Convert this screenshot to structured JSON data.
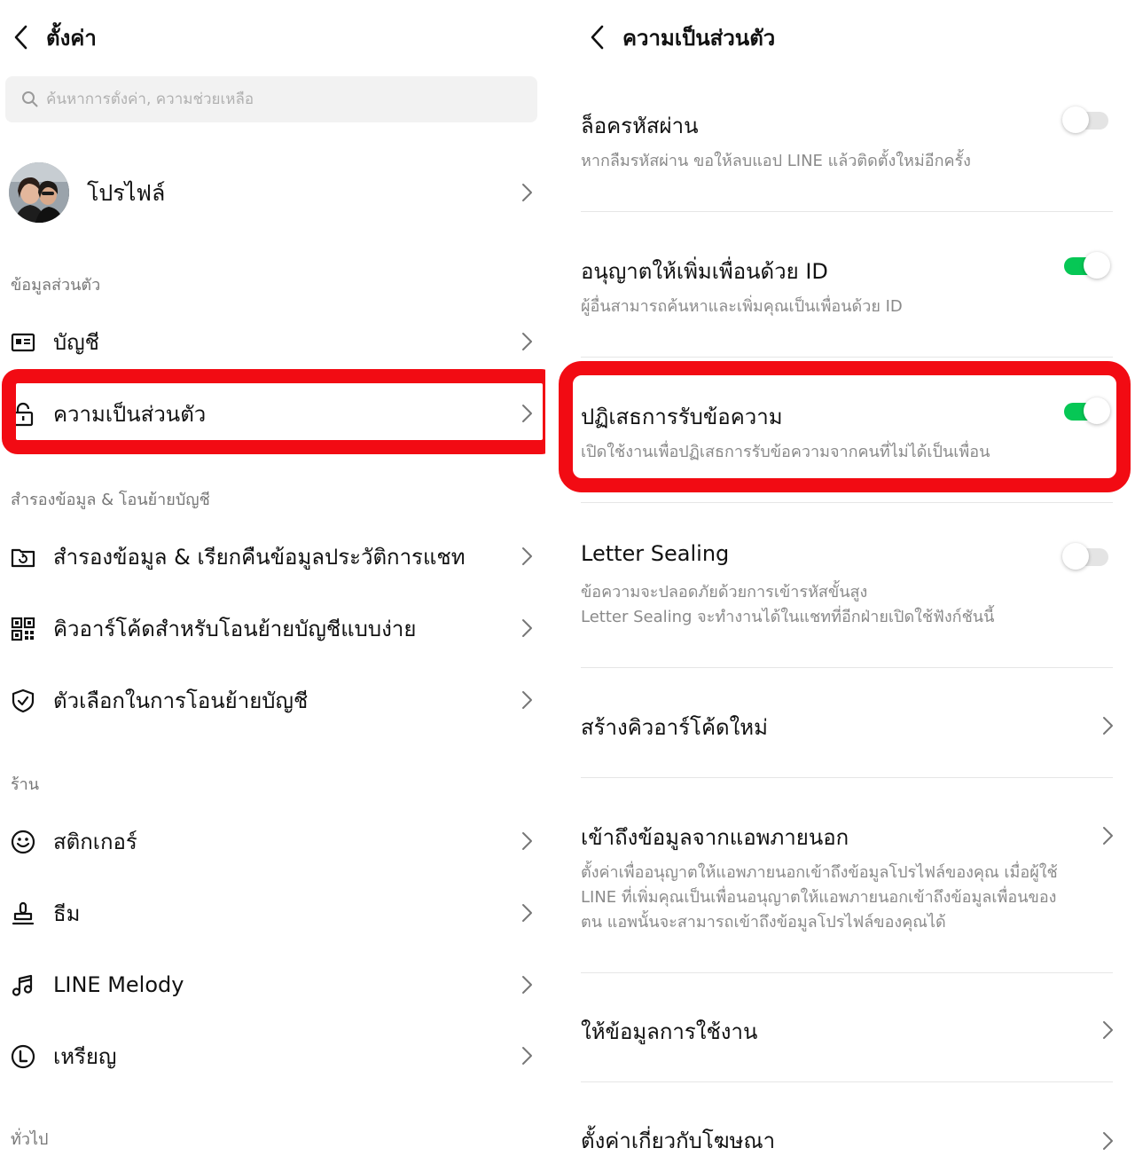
{
  "left": {
    "title": "ตั้งค่า",
    "search_placeholder": "ค้นหาการตั้งค่า, ความช่วยเหลือ",
    "profile_label": "โปรไฟล์",
    "sections": {
      "personal": "ข้อมูลส่วนตัว",
      "backup": "สำรองข้อมูล & โอนย้ายบัญชี",
      "shop": "ร้าน",
      "general": "ทั่วไป"
    },
    "items": {
      "account": "บัญชี",
      "privacy": "ความเป็นส่วนตัว",
      "backup_restore": "สำรองข้อมูล & เรียกคืนข้อมูลประวัติการแชท",
      "qr_transfer": "คิวอาร์โค้ดสำหรับโอนย้ายบัญชีแบบง่าย",
      "transfer_options": "ตัวเลือกในการโอนย้ายบัญชี",
      "stickers": "สติกเกอร์",
      "themes": "ธีม",
      "line_melody": "LINE Melody",
      "coins": "เหรียญ"
    }
  },
  "right": {
    "title": "ความเป็นส่วนตัว",
    "passcode_lock": {
      "title": "ล็อครหัสผ่าน",
      "desc": "หากลืมรหัสผ่าน ขอให้ลบแอป LINE แล้วติดตั้งใหม่อีกครั้ง",
      "enabled": false
    },
    "allow_add_by_id": {
      "title": "อนุญาตให้เพิ่มเพื่อนด้วย ID",
      "desc": "ผู้อื่นสามารถค้นหาและเพิ่มคุณเป็นเพื่อนด้วย ID",
      "enabled": true
    },
    "filter_messages": {
      "title": "ปฏิเสธการรับข้อความ",
      "desc": "เปิดใช้งานเพื่อปฏิเสธการรับข้อความจากคนที่ไม่ได้เป็นเพื่อน",
      "enabled": true
    },
    "letter_sealing": {
      "title": "Letter Sealing",
      "desc_line1": "ข้อความจะปลอดภัยด้วยการเข้ารหัสขั้นสูง",
      "desc_line2": "Letter Sealing จะทำงานได้ในแชทที่อีกฝ่ายเปิดใช้ฟังก์ชันนี้",
      "enabled": false
    },
    "new_qr": {
      "title": "สร้างคิวอาร์โค้ดใหม่"
    },
    "external_access": {
      "title": "เข้าถึงข้อมูลจากแอพภายนอก",
      "desc_line1": "ตั้งค่าเพื่ออนุญาตให้แอพภายนอกเข้าถึงข้อมูลโปรไฟล์ของคุณ เมื่อผู้ใช้",
      "desc_line2": "LINE ที่เพิ่มคุณเป็นเพื่อนอนุญาตให้แอพภายนอกเข้าถึงข้อมูลเพื่อนของ",
      "desc_line3": "ตน แอพนั้นจะสามารถเข้าถึงข้อมูลโปรไฟล์ของคุณได้"
    },
    "usage_data": {
      "title": "ให้ข้อมูลการใช้งาน"
    },
    "ad_settings": {
      "title": "ตั้งค่าเกี่ยวกับโฆษณา"
    }
  },
  "colors": {
    "accent_green": "#06c755",
    "highlight_red": "#f20b13",
    "text_secondary": "#8a8a8a"
  }
}
